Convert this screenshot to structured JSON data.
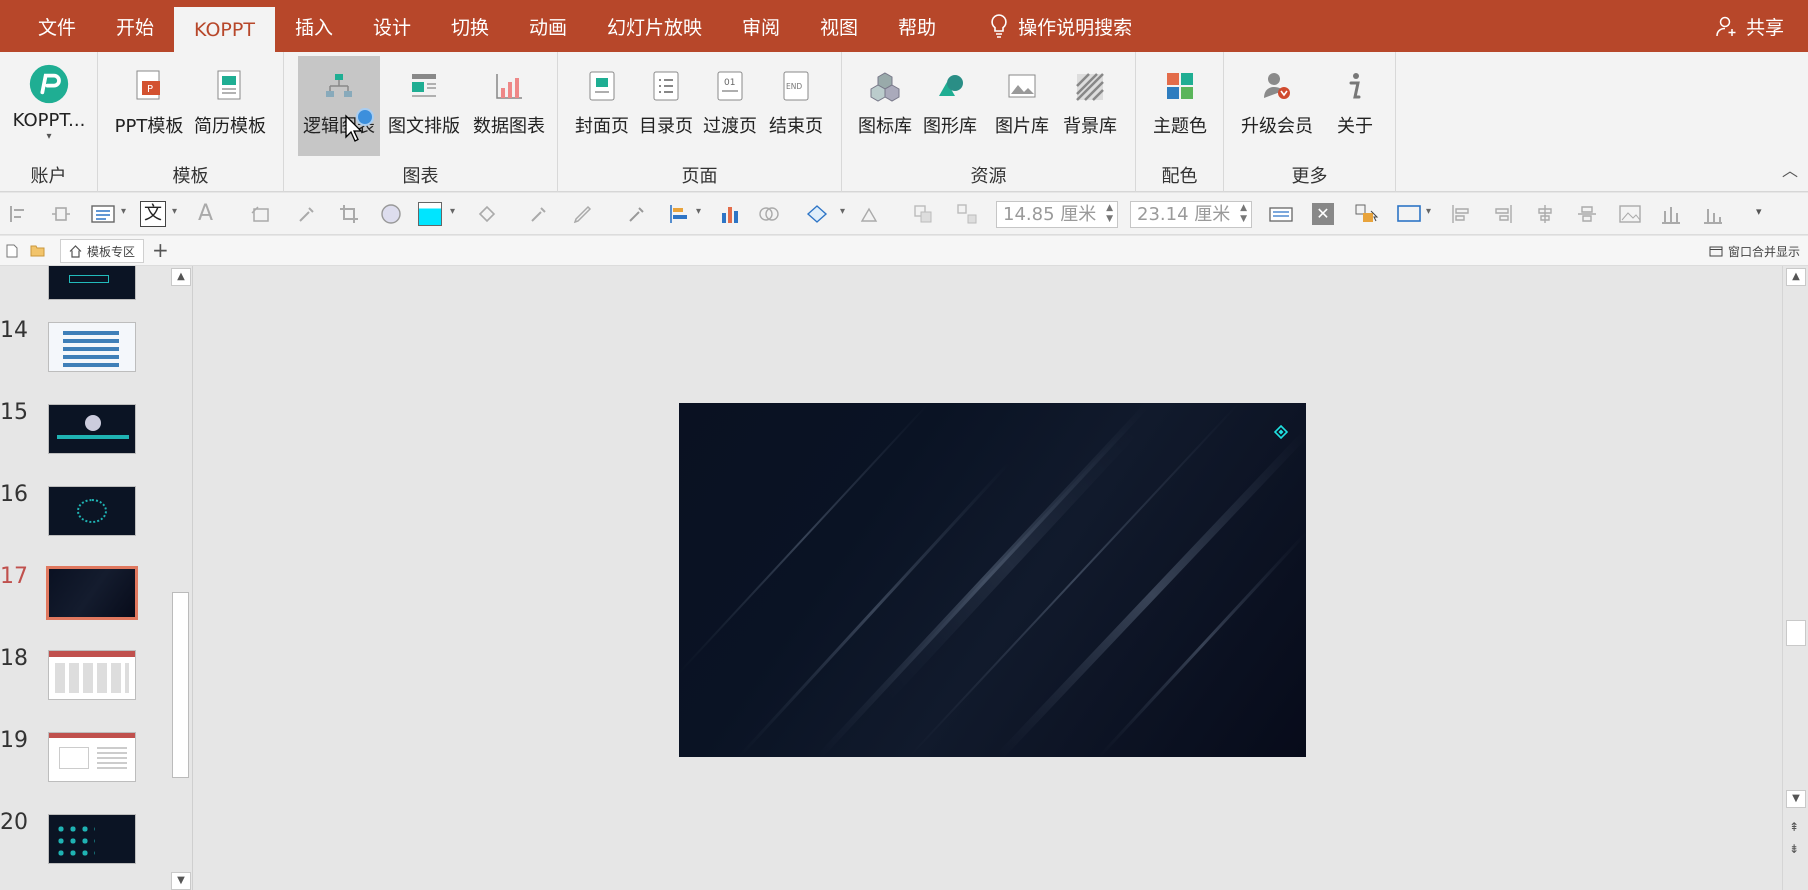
{
  "tabs": [
    {
      "label": "文件"
    },
    {
      "label": "开始"
    },
    {
      "label": "KOPPT"
    },
    {
      "label": "插入"
    },
    {
      "label": "设计"
    },
    {
      "label": "切换"
    },
    {
      "label": "动画"
    },
    {
      "label": "幻灯片放映"
    },
    {
      "label": "审阅"
    },
    {
      "label": "视图"
    },
    {
      "label": "帮助"
    }
  ],
  "tell_me": "操作说明搜索",
  "share": "共享",
  "ribbon": {
    "groups": [
      {
        "label": "账户",
        "buttons": [
          {
            "label": "KOPPT..."
          }
        ]
      },
      {
        "label": "模板",
        "buttons": [
          {
            "label": "PPT模板"
          },
          {
            "label": "简历模板"
          }
        ]
      },
      {
        "label": "图表",
        "buttons": [
          {
            "label": "逻辑图表"
          },
          {
            "label": "图文排版"
          },
          {
            "label": "数据图表"
          }
        ]
      },
      {
        "label": "页面",
        "buttons": [
          {
            "label": "封面页"
          },
          {
            "label": "目录页"
          },
          {
            "label": "过渡页"
          },
          {
            "label": "结束页"
          }
        ]
      },
      {
        "label": "资源",
        "buttons": [
          {
            "label": "图标库"
          },
          {
            "label": "图形库"
          },
          {
            "label": "图片库"
          },
          {
            "label": "背景库"
          }
        ]
      },
      {
        "label": "配色",
        "buttons": [
          {
            "label": "主题色"
          }
        ]
      },
      {
        "label": "更多",
        "buttons": [
          {
            "label": "升级会员"
          },
          {
            "label": "关于"
          }
        ]
      }
    ]
  },
  "toolbar": {
    "height_value": "14.85 厘米",
    "width_value": "23.14 厘米"
  },
  "doc_tabs": {
    "home_label": "模板专区",
    "merge_label": "窗口合并显示"
  },
  "slides": [
    {
      "number": "14"
    },
    {
      "number": "15"
    },
    {
      "number": "16"
    },
    {
      "number": "17"
    },
    {
      "number": "18"
    },
    {
      "number": "19"
    },
    {
      "number": "20"
    }
  ],
  "colors": {
    "accent": "#b7472a",
    "ribbon_bg": "#f3f3f3",
    "selected_slide": "#e0785f",
    "slide_bg": "#0a1122"
  }
}
